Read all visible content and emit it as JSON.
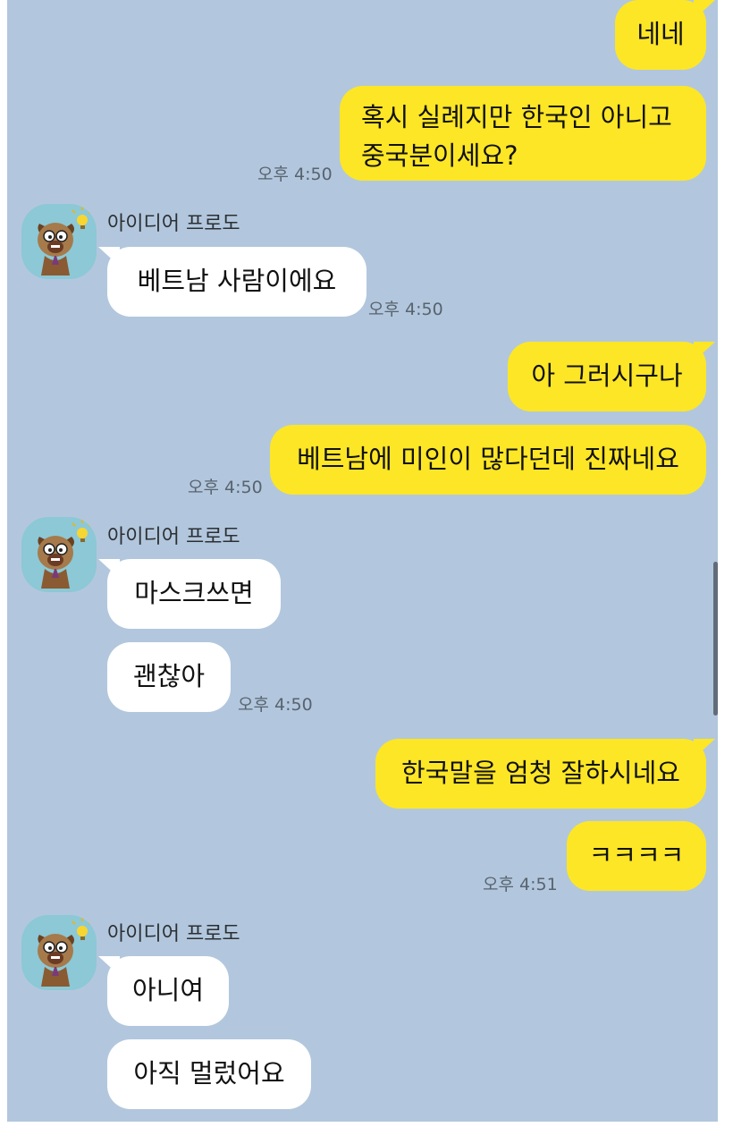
{
  "chat": {
    "sender_name": "아이디어 프로도",
    "messages": {
      "m1": "네네",
      "m2_line1": "혹시 실례지만 한국인 아니고",
      "m2_line2": "중국분이세요?",
      "m3": "베트남 사람이에요",
      "m4": "아 그러시구나",
      "m5": "베트남에 미인이 많다던데 진짜네요",
      "m6": "마스크쓰면",
      "m7": "괜찮아",
      "m8": "한국말을 엄청 잘하시네요",
      "m9": "ㅋㅋㅋㅋ",
      "m10": "아니여",
      "m11": "아직 멀렀어요"
    },
    "times": {
      "t1": "오후 4:50",
      "t2": "오후 4:50",
      "t3": "오후 4:50",
      "t4": "오후 4:50",
      "t5": "오후 4:51"
    },
    "colors": {
      "background": "#b2c7dd",
      "my_bubble": "#fde626",
      "their_bubble": "#ffffff"
    },
    "avatar_icon": "frodo-dog-lightbulb-icon"
  }
}
